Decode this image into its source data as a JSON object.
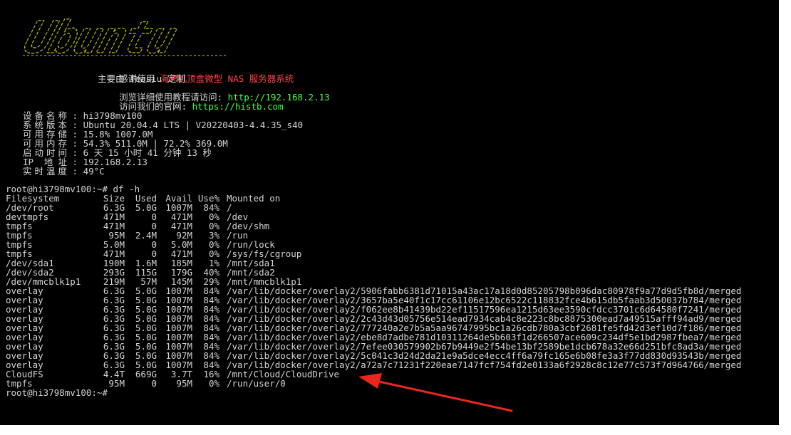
{
  "banner": {
    "logo_text": "Ubuntu"
  },
  "intro": {
    "line1_prefix": "感谢使用 ",
    "line1_highlight": "海思机顶盒微型 NAS 服务器系统",
    "line2": "主要由 Teasiu 定制",
    "line3_prefix": "浏览详细使用教程请访问: ",
    "line3_url": "http://192.168.2.13",
    "line4_prefix": "访问我们的官网: ",
    "line4_url": "https://histb.com"
  },
  "sysinfo": [
    {
      "label": "设备名称",
      "value": "hi3798mv100"
    },
    {
      "label": "系统版本",
      "value": "Ubuntu 20.04.4 LTS | V20220403-4.4.35_s40"
    },
    {
      "label": "可用存储",
      "value": "15.8% 1007.0M"
    },
    {
      "label": "可用内存",
      "value": "54.3% 511.0M | 72.2% 369.0M"
    },
    {
      "label": "启动时间",
      "value": "6 天 15 小时 41 分钟 13 秒"
    },
    {
      "label": "IP 地址",
      "value": "192.168.2.13"
    },
    {
      "label": "实时温度",
      "value": "49°C"
    }
  ],
  "prompt": {
    "command_line": "root@hi3798mv100:~# df -h",
    "final_prompt": "root@hi3798mv100:~#"
  },
  "df": {
    "headers": [
      "Filesystem",
      "Size",
      "Used",
      "Avail",
      "Use%",
      "Mounted on"
    ],
    "rows": [
      [
        "/dev/root",
        "6.3G",
        "5.0G",
        "1007M",
        "84%",
        "/"
      ],
      [
        "devtmpfs",
        "471M",
        "0",
        "471M",
        "0%",
        "/dev"
      ],
      [
        "tmpfs",
        "471M",
        "0",
        "471M",
        "0%",
        "/dev/shm"
      ],
      [
        "tmpfs",
        "95M",
        "2.4M",
        "92M",
        "3%",
        "/run"
      ],
      [
        "tmpfs",
        "5.0M",
        "0",
        "5.0M",
        "0%",
        "/run/lock"
      ],
      [
        "tmpfs",
        "471M",
        "0",
        "471M",
        "0%",
        "/sys/fs/cgroup"
      ],
      [
        "/dev/sda1",
        "190M",
        "1.6M",
        "185M",
        "1%",
        "/mnt/sda1"
      ],
      [
        "/dev/sda2",
        "293G",
        "115G",
        "179G",
        "40%",
        "/mnt/sda2"
      ],
      [
        "/dev/mmcblk1p1",
        "219M",
        "57M",
        "145M",
        "29%",
        "/mnt/mmcblk1p1"
      ],
      [
        "overlay",
        "6.3G",
        "5.0G",
        "1007M",
        "84%",
        "/var/lib/docker/overlay2/5906fabb6381d71015a43ac17a18d0d85205798b096dac80978f9a77d9d5fb8d/merged"
      ],
      [
        "overlay",
        "6.3G",
        "5.0G",
        "1007M",
        "84%",
        "/var/lib/docker/overlay2/3657ba5e40f1c17cc61106e12bc6522c118832fce4b615db5faab3d50037b784/merged"
      ],
      [
        "overlay",
        "6.3G",
        "5.0G",
        "1007M",
        "84%",
        "/var/lib/docker/overlay2/f062ee8b41439bd22ef11517596ea1215d63ee3590cfdcc3701c6d64580f7241/merged"
      ],
      [
        "overlay",
        "6.3G",
        "5.0G",
        "1007M",
        "84%",
        "/var/lib/docker/overlay2/2c43d43d05756e514ead7934cab4c8e223c8bc8875300ead7a49515afff94ad9/merged"
      ],
      [
        "overlay",
        "6.3G",
        "5.0G",
        "1007M",
        "84%",
        "/var/lib/docker/overlay2/777240a2e7b5a5aa96747995bc1a26cdb780a3cbf2681fe5fd42d3ef10d7f186/merged"
      ],
      [
        "overlay",
        "6.3G",
        "5.0G",
        "1007M",
        "84%",
        "/var/lib/docker/overlay2/ebe8d7adbe781d10311264de5b603f1d266507ace609c234df5e1bd2987fbea7/merged"
      ],
      [
        "overlay",
        "6.3G",
        "5.0G",
        "1007M",
        "84%",
        "/var/lib/docker/overlay2/7efee030579902b67b9449e2f54be13bf2589be1dcb678a32e66d251bfc8ad3a/merged"
      ],
      [
        "overlay",
        "6.3G",
        "5.0G",
        "1007M",
        "84%",
        "/var/lib/docker/overlay2/5c041c3d24d2da21e9a5dce4ecc4ff6a79fc165e6b08fe3a3f77dd830d93543b/merged"
      ],
      [
        "overlay",
        "6.3G",
        "5.0G",
        "1007M",
        "84%",
        "/var/lib/docker/overlay2/a72a7c71231f220eae7147fcf754fd2e0133a6f2928c8c12e77c573f7d964766/merged"
      ],
      [
        "CloudFS",
        "4.4T",
        "669G",
        "3.7T",
        "16%",
        "/mnt/Cloud/CloudDrive"
      ],
      [
        "tmpfs",
        "95M",
        "0",
        "95M",
        "0%",
        "/run/user/0"
      ]
    ]
  },
  "colors": {
    "terminal_bg": "#000000",
    "text": "#d4d4d4",
    "logo": "#c8c800",
    "highlight_red": "#ff4444",
    "url_green": "#44ff44",
    "annotation_arrow": "#e8261c"
  }
}
